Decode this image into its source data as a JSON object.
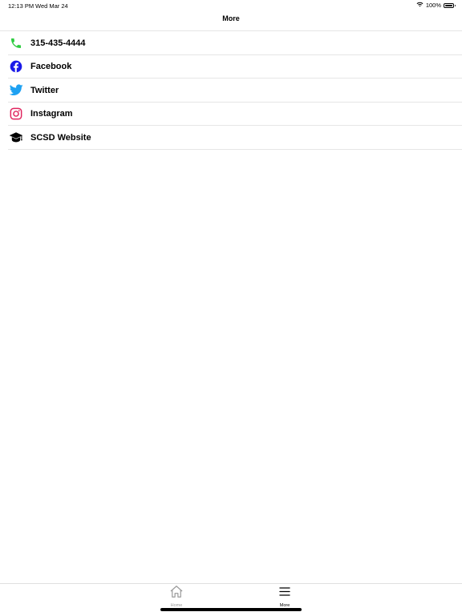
{
  "status_bar": {
    "time": "12:13 PM",
    "date": "Wed Mar 24",
    "battery": "100%"
  },
  "nav": {
    "title": "More"
  },
  "menu": {
    "items": [
      {
        "label": "315-435-4444",
        "icon": "phone-icon",
        "color": "#2ecc40"
      },
      {
        "label": "Facebook",
        "icon": "facebook-icon",
        "color": "#1a1ae8"
      },
      {
        "label": "Twitter",
        "icon": "twitter-icon",
        "color": "#1da1f2"
      },
      {
        "label": "Instagram",
        "icon": "instagram-icon",
        "color": "#e0245e"
      },
      {
        "label": "SCSD Website",
        "icon": "graduation-cap-icon",
        "color": "#000000"
      }
    ]
  },
  "tab_bar": {
    "tabs": [
      {
        "label": "Home",
        "icon": "home-icon",
        "active": false
      },
      {
        "label": "More",
        "icon": "menu-icon",
        "active": true
      }
    ]
  }
}
